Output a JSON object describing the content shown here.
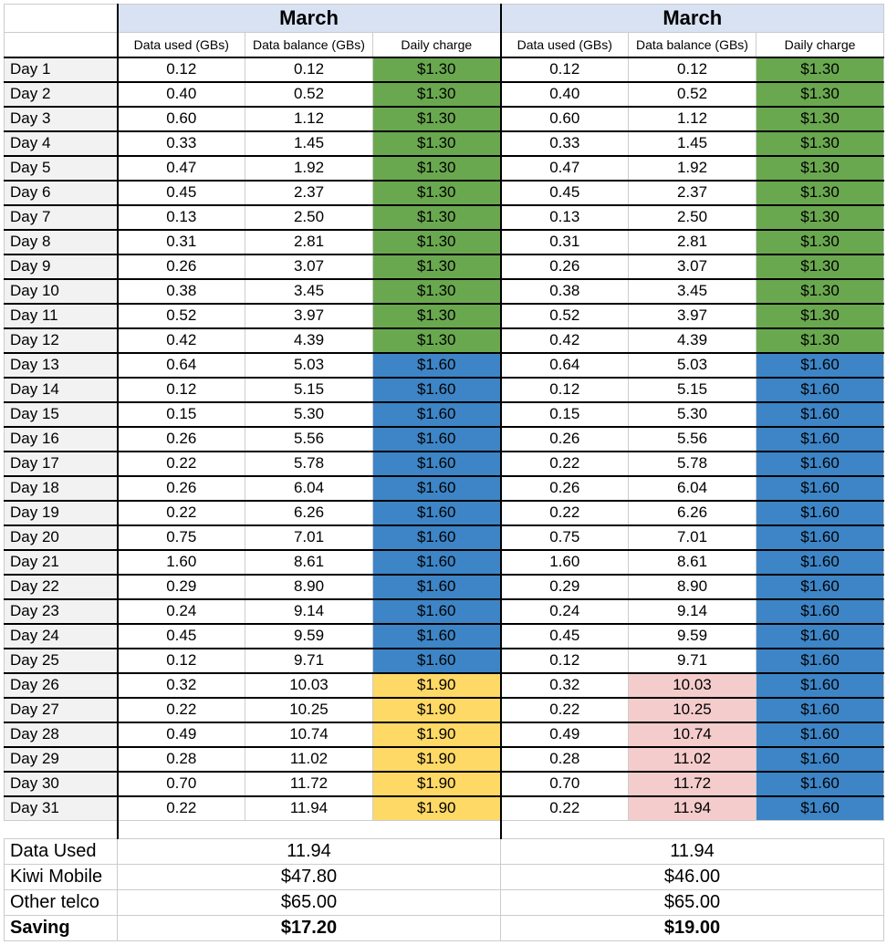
{
  "headers": {
    "month_left": "March",
    "month_right": "March",
    "sub1": "Data used (GBs)",
    "sub2": "Data balance (GBs)",
    "sub3": "Daily charge"
  },
  "colors": {
    "green": "#6aa84f",
    "blue": "#3d85c6",
    "yellow": "#ffd966",
    "pink": "#f4cccc"
  },
  "rows": [
    {
      "day": "Day 1",
      "u": "0.12",
      "b": "0.12",
      "c1": "$1.30",
      "c1c": "green",
      "b2": "0.12",
      "c2": "$1.30",
      "c2c": "green",
      "b2c": ""
    },
    {
      "day": "Day 2",
      "u": "0.40",
      "b": "0.52",
      "c1": "$1.30",
      "c1c": "green",
      "b2": "0.52",
      "c2": "$1.30",
      "c2c": "green",
      "b2c": ""
    },
    {
      "day": "Day 3",
      "u": "0.60",
      "b": "1.12",
      "c1": "$1.30",
      "c1c": "green",
      "b2": "1.12",
      "c2": "$1.30",
      "c2c": "green",
      "b2c": ""
    },
    {
      "day": "Day 4",
      "u": "0.33",
      "b": "1.45",
      "c1": "$1.30",
      "c1c": "green",
      "b2": "1.45",
      "c2": "$1.30",
      "c2c": "green",
      "b2c": ""
    },
    {
      "day": "Day 5",
      "u": "0.47",
      "b": "1.92",
      "c1": "$1.30",
      "c1c": "green",
      "b2": "1.92",
      "c2": "$1.30",
      "c2c": "green",
      "b2c": ""
    },
    {
      "day": "Day 6",
      "u": "0.45",
      "b": "2.37",
      "c1": "$1.30",
      "c1c": "green",
      "b2": "2.37",
      "c2": "$1.30",
      "c2c": "green",
      "b2c": ""
    },
    {
      "day": "Day 7",
      "u": "0.13",
      "b": "2.50",
      "c1": "$1.30",
      "c1c": "green",
      "b2": "2.50",
      "c2": "$1.30",
      "c2c": "green",
      "b2c": ""
    },
    {
      "day": "Day 8",
      "u": "0.31",
      "b": "2.81",
      "c1": "$1.30",
      "c1c": "green",
      "b2": "2.81",
      "c2": "$1.30",
      "c2c": "green",
      "b2c": ""
    },
    {
      "day": "Day 9",
      "u": "0.26",
      "b": "3.07",
      "c1": "$1.30",
      "c1c": "green",
      "b2": "3.07",
      "c2": "$1.30",
      "c2c": "green",
      "b2c": ""
    },
    {
      "day": "Day 10",
      "u": "0.38",
      "b": "3.45",
      "c1": "$1.30",
      "c1c": "green",
      "b2": "3.45",
      "c2": "$1.30",
      "c2c": "green",
      "b2c": ""
    },
    {
      "day": "Day 11",
      "u": "0.52",
      "b": "3.97",
      "c1": "$1.30",
      "c1c": "green",
      "b2": "3.97",
      "c2": "$1.30",
      "c2c": "green",
      "b2c": ""
    },
    {
      "day": "Day 12",
      "u": "0.42",
      "b": "4.39",
      "c1": "$1.30",
      "c1c": "green",
      "b2": "4.39",
      "c2": "$1.30",
      "c2c": "green",
      "b2c": ""
    },
    {
      "day": "Day 13",
      "u": "0.64",
      "b": "5.03",
      "c1": "$1.60",
      "c1c": "blue",
      "b2": "5.03",
      "c2": "$1.60",
      "c2c": "blue",
      "b2c": ""
    },
    {
      "day": "Day 14",
      "u": "0.12",
      "b": "5.15",
      "c1": "$1.60",
      "c1c": "blue",
      "b2": "5.15",
      "c2": "$1.60",
      "c2c": "blue",
      "b2c": ""
    },
    {
      "day": "Day 15",
      "u": "0.15",
      "b": "5.30",
      "c1": "$1.60",
      "c1c": "blue",
      "b2": "5.30",
      "c2": "$1.60",
      "c2c": "blue",
      "b2c": ""
    },
    {
      "day": "Day 16",
      "u": "0.26",
      "b": "5.56",
      "c1": "$1.60",
      "c1c": "blue",
      "b2": "5.56",
      "c2": "$1.60",
      "c2c": "blue",
      "b2c": ""
    },
    {
      "day": "Day 17",
      "u": "0.22",
      "b": "5.78",
      "c1": "$1.60",
      "c1c": "blue",
      "b2": "5.78",
      "c2": "$1.60",
      "c2c": "blue",
      "b2c": ""
    },
    {
      "day": "Day 18",
      "u": "0.26",
      "b": "6.04",
      "c1": "$1.60",
      "c1c": "blue",
      "b2": "6.04",
      "c2": "$1.60",
      "c2c": "blue",
      "b2c": ""
    },
    {
      "day": "Day 19",
      "u": "0.22",
      "b": "6.26",
      "c1": "$1.60",
      "c1c": "blue",
      "b2": "6.26",
      "c2": "$1.60",
      "c2c": "blue",
      "b2c": ""
    },
    {
      "day": "Day 20",
      "u": "0.75",
      "b": "7.01",
      "c1": "$1.60",
      "c1c": "blue",
      "b2": "7.01",
      "c2": "$1.60",
      "c2c": "blue",
      "b2c": ""
    },
    {
      "day": "Day 21",
      "u": "1.60",
      "b": "8.61",
      "c1": "$1.60",
      "c1c": "blue",
      "b2": "8.61",
      "c2": "$1.60",
      "c2c": "blue",
      "b2c": ""
    },
    {
      "day": "Day 22",
      "u": "0.29",
      "b": "8.90",
      "c1": "$1.60",
      "c1c": "blue",
      "b2": "8.90",
      "c2": "$1.60",
      "c2c": "blue",
      "b2c": ""
    },
    {
      "day": "Day 23",
      "u": "0.24",
      "b": "9.14",
      "c1": "$1.60",
      "c1c": "blue",
      "b2": "9.14",
      "c2": "$1.60",
      "c2c": "blue",
      "b2c": ""
    },
    {
      "day": "Day 24",
      "u": "0.45",
      "b": "9.59",
      "c1": "$1.60",
      "c1c": "blue",
      "b2": "9.59",
      "c2": "$1.60",
      "c2c": "blue",
      "b2c": ""
    },
    {
      "day": "Day 25",
      "u": "0.12",
      "b": "9.71",
      "c1": "$1.60",
      "c1c": "blue",
      "b2": "9.71",
      "c2": "$1.60",
      "c2c": "blue",
      "b2c": ""
    },
    {
      "day": "Day 26",
      "u": "0.32",
      "b": "10.03",
      "c1": "$1.90",
      "c1c": "yellow",
      "b2": "10.03",
      "c2": "$1.60",
      "c2c": "blue",
      "b2c": "pink"
    },
    {
      "day": "Day 27",
      "u": "0.22",
      "b": "10.25",
      "c1": "$1.90",
      "c1c": "yellow",
      "b2": "10.25",
      "c2": "$1.60",
      "c2c": "blue",
      "b2c": "pink"
    },
    {
      "day": "Day 28",
      "u": "0.49",
      "b": "10.74",
      "c1": "$1.90",
      "c1c": "yellow",
      "b2": "10.74",
      "c2": "$1.60",
      "c2c": "blue",
      "b2c": "pink"
    },
    {
      "day": "Day 29",
      "u": "0.28",
      "b": "11.02",
      "c1": "$1.90",
      "c1c": "yellow",
      "b2": "11.02",
      "c2": "$1.60",
      "c2c": "blue",
      "b2c": "pink"
    },
    {
      "day": "Day 30",
      "u": "0.70",
      "b": "11.72",
      "c1": "$1.90",
      "c1c": "yellow",
      "b2": "11.72",
      "c2": "$1.60",
      "c2c": "blue",
      "b2c": "pink"
    },
    {
      "day": "Day 31",
      "u": "0.22",
      "b": "11.94",
      "c1": "$1.90",
      "c1c": "yellow",
      "b2": "11.94",
      "c2": "$1.60",
      "c2c": "blue",
      "b2c": "pink"
    }
  ],
  "summary": {
    "data_used_label": "Data Used",
    "data_used_left": "11.94",
    "data_used_right": "11.94",
    "kiwi_label": "Kiwi Mobile",
    "kiwi_left": "$47.80",
    "kiwi_right": "$46.00",
    "other_label": "Other telco",
    "other_left": "$65.00",
    "other_right": "$65.00",
    "saving_label": "Saving",
    "saving_left": "$17.20",
    "saving_right": "$19.00"
  }
}
